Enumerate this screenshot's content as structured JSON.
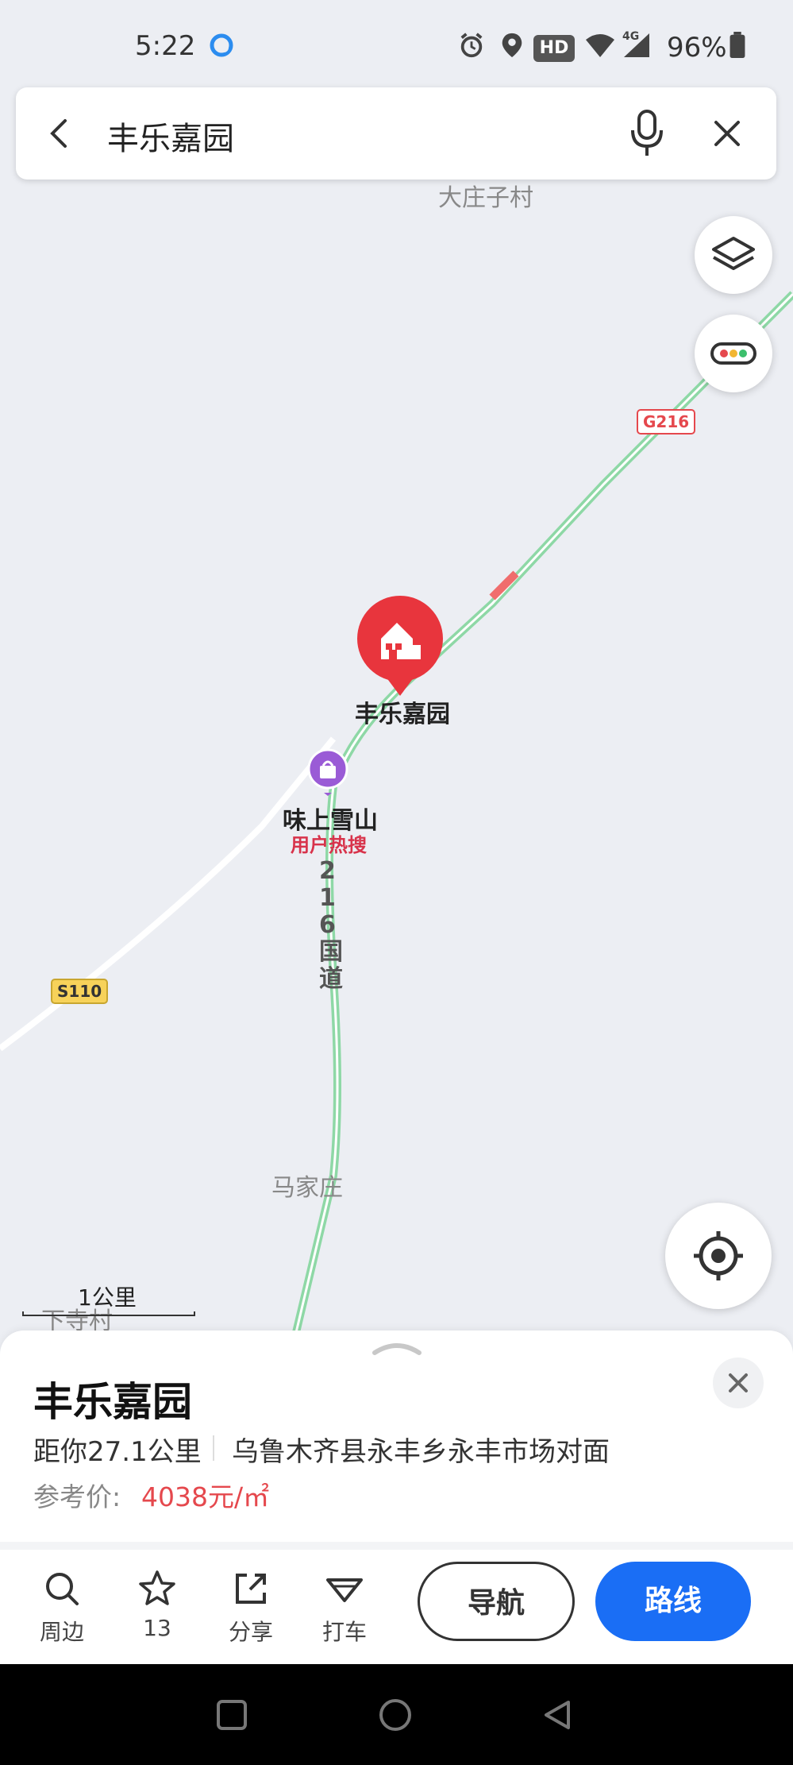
{
  "status": {
    "time": "5:22",
    "hd_badge": "HD",
    "network": "4G",
    "battery": "96%"
  },
  "search": {
    "query": "丰乐嘉园",
    "back_icon": "back-arrow-icon",
    "mic_icon": "microphone-icon",
    "clear_icon": "close-icon"
  },
  "map": {
    "labels": {
      "village_top": "大庄子村",
      "road_g216": "G216",
      "road_s110": "S110",
      "pin_name": "丰乐嘉园",
      "poi_name": "味上雪山",
      "poi_tag": "用户热搜",
      "road_vertical": "216国道",
      "majiazhuang": "马家庄",
      "xiasicun": "下寺村",
      "scale": "1公里"
    },
    "colors": {
      "pin": "#e8353d",
      "poi": "#9a5bd6",
      "road_green": "#8ed8a6",
      "road_red": "#f06d6d"
    }
  },
  "panel": {
    "title": "丰乐嘉园",
    "distance": "距你27.1公里",
    "address": "乌鲁木齐县永丰乡永丰市场对面",
    "price_label": "参考价:",
    "price_value": "4038元/㎡",
    "actions": [
      {
        "label": "周边",
        "icon": "search-icon"
      },
      {
        "label": "13",
        "icon": "star-icon"
      },
      {
        "label": "分享",
        "icon": "share-icon"
      },
      {
        "label": "打车",
        "icon": "taxi-icon"
      }
    ],
    "nav_button": "导航",
    "route_button": "路线"
  }
}
